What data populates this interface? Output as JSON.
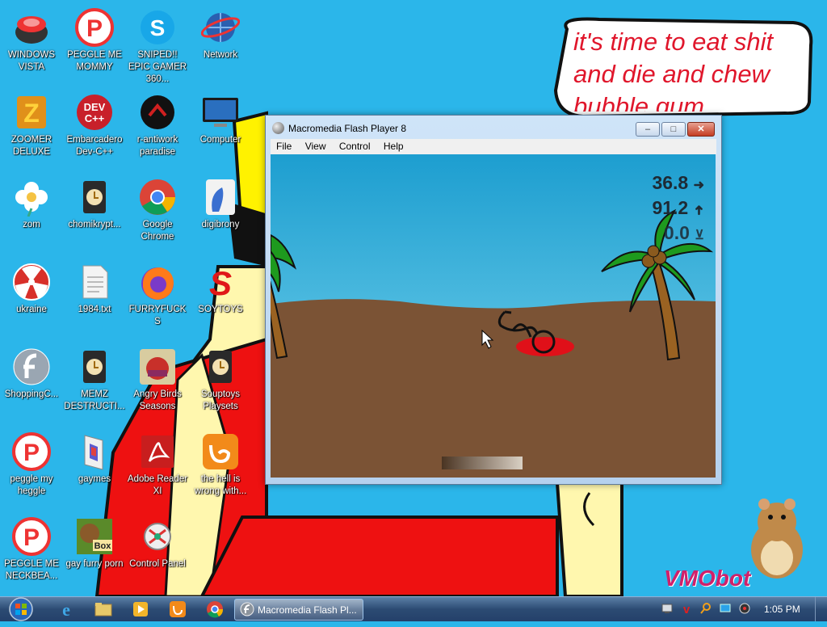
{
  "desktop": {
    "icons": [
      {
        "label": "WINDOWS VISTA",
        "icon": "windows-vista-icon"
      },
      {
        "label": "PEGGLE ME MOMMY",
        "icon": "peggle-icon"
      },
      {
        "label": "SNIPED!! EPIC GAMER 360...",
        "icon": "skype-icon"
      },
      {
        "label": "Network",
        "icon": "network-icon"
      },
      {
        "label": "ZOOMER DELUXE",
        "icon": "zuma-icon"
      },
      {
        "label": "Embarcadero Dev-C++",
        "icon": "devcpp-icon"
      },
      {
        "label": "r-antiwork paradise",
        "icon": "antiwork-icon"
      },
      {
        "label": "Computer",
        "icon": "computer-icon"
      },
      {
        "label": "zom",
        "icon": "flower-icon"
      },
      {
        "label": "chomikrypt...",
        "icon": "installer-icon"
      },
      {
        "label": "Google Chrome",
        "icon": "chrome-icon"
      },
      {
        "label": "digibrony",
        "icon": "pony-icon"
      },
      {
        "label": "ukraine",
        "icon": "radiation-icon"
      },
      {
        "label": "1984.txt",
        "icon": "text-file-icon"
      },
      {
        "label": "FURRYFUCKS",
        "icon": "firefox-icon"
      },
      {
        "label": "SOYTOYS",
        "icon": "soytoys-icon"
      },
      {
        "label": "ShoppingC...",
        "icon": "flash-icon"
      },
      {
        "label": "MEMZ DESTRUCTI...",
        "icon": "installer-icon"
      },
      {
        "label": "Angry Birds Seasons",
        "icon": "angry-birds-icon"
      },
      {
        "label": "Souptoys Playsets",
        "icon": "installer-icon"
      },
      {
        "label": "peggle my heggle",
        "icon": "peggle-icon"
      },
      {
        "label": "gaymes",
        "icon": "folder-icon"
      },
      {
        "label": "Adobe Reader XI",
        "icon": "adobe-reader-icon"
      },
      {
        "label": "the hell is wrong with...",
        "icon": "uc-browser-icon"
      },
      {
        "label": "PEGGLE ME NECKBEA...",
        "icon": "peggle-icon"
      },
      {
        "label": "gay furry porn",
        "icon": "box-icon"
      },
      {
        "label": "Control Panel",
        "icon": "control-panel-icon"
      }
    ],
    "speech_bubble": {
      "line1": "it's time to eat shit",
      "line2": "and die and chew",
      "line3": "bubble gum"
    },
    "watermark": "VMObot"
  },
  "window": {
    "title": "Macromedia Flash Player 8",
    "menu": [
      "File",
      "View",
      "Control",
      "Help"
    ],
    "buttons": {
      "minimize": "–",
      "maximize": "□",
      "close": "✕"
    }
  },
  "game": {
    "speed": "36.8",
    "height": "91.2",
    "angle": "0.0",
    "speed_arrow": "➜",
    "height_arrow": "➜",
    "angle_symbol": "⊻",
    "power": 0.0
  },
  "taskbar": {
    "active_task": "Macromedia Flash Pl...",
    "clock": "1:05 PM",
    "quick_launch": [
      "ie-icon",
      "explorer-icon",
      "media-player-icon",
      "uc-browser-icon",
      "chrome-icon"
    ],
    "tray": [
      "network-tray-icon",
      "antivirus-tray-icon",
      "search-tray-icon",
      "display-tray-icon",
      "volume-tray-icon"
    ]
  },
  "colors": {
    "sky": "#2bb6ea",
    "sand": "#7b5335",
    "bubble_text": "#e0162b",
    "blood": "#e01019"
  }
}
